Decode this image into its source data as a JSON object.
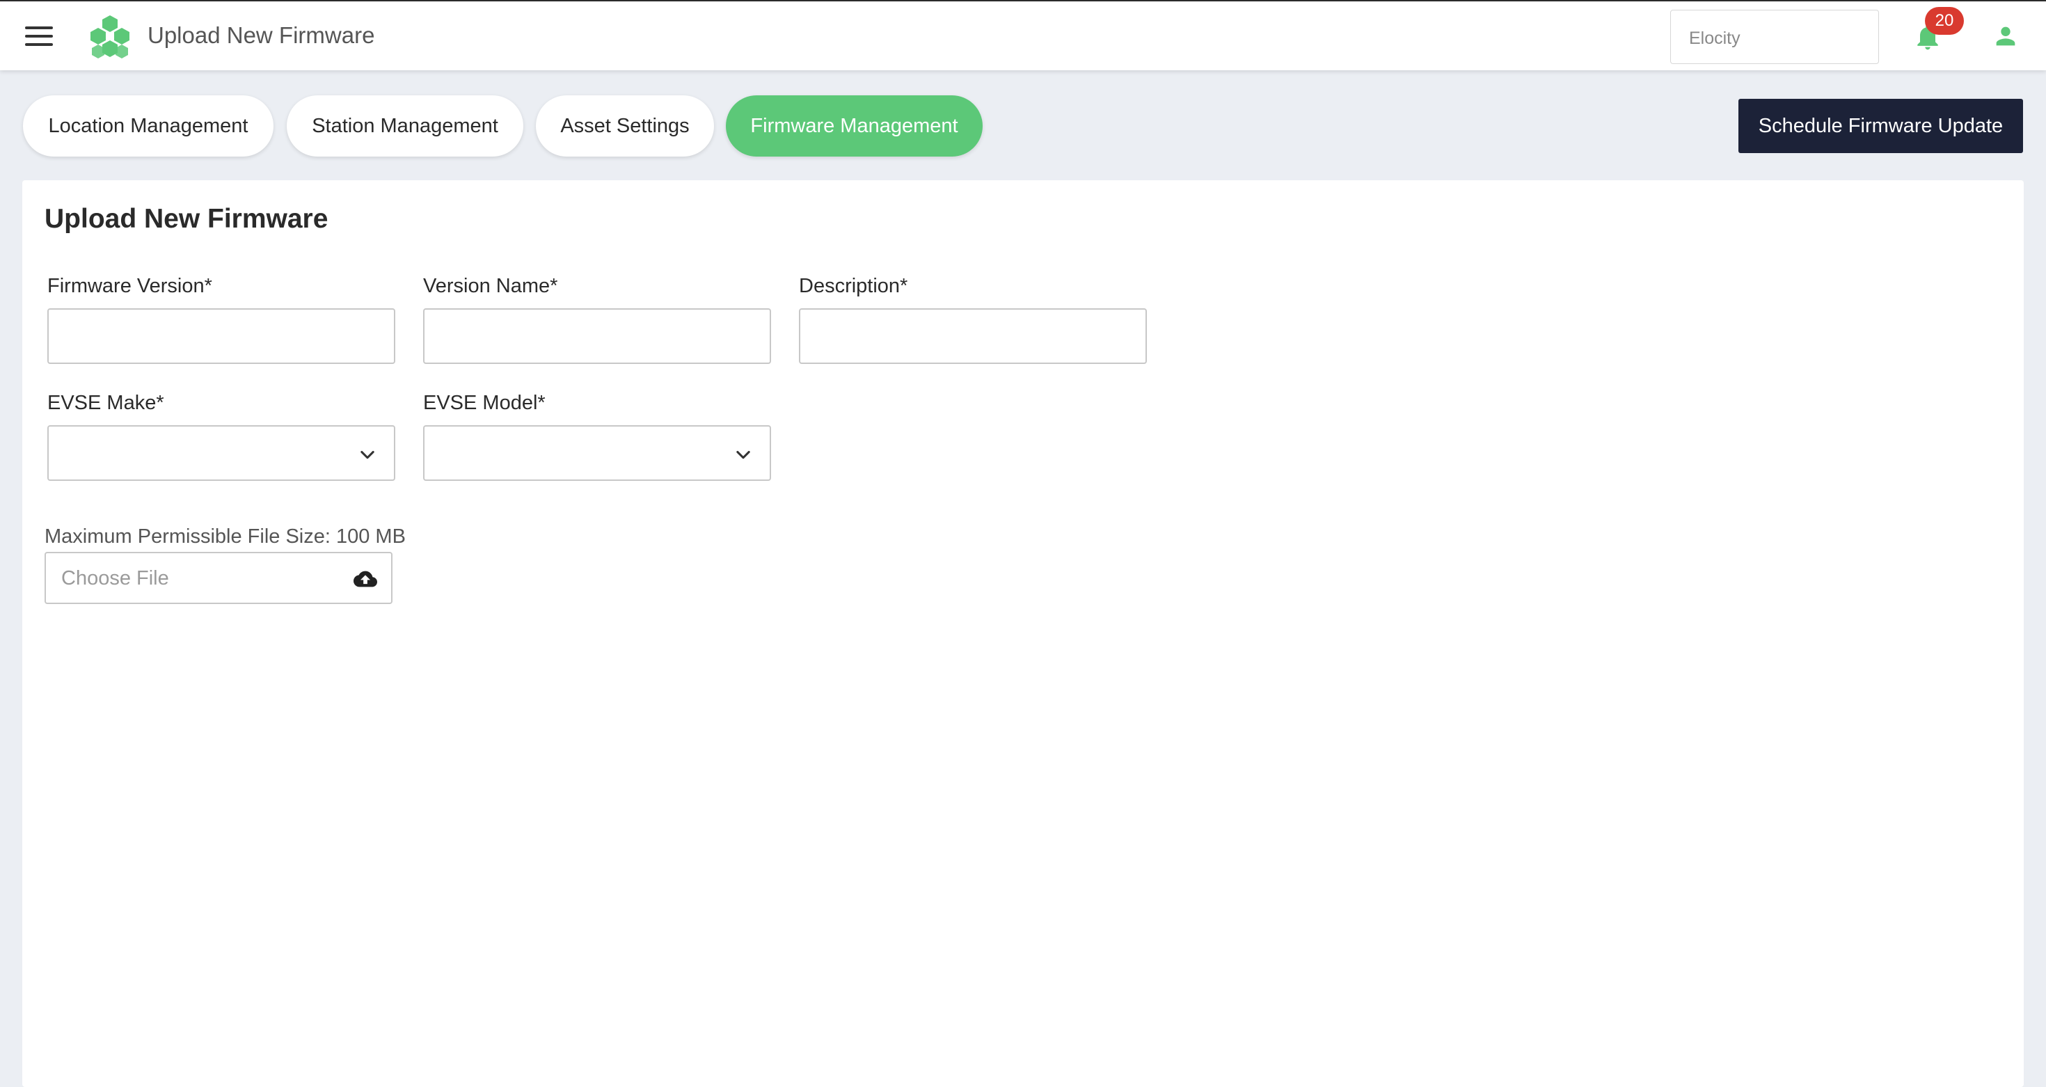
{
  "header": {
    "app_title": "Upload New Firmware",
    "org_select_value": "Elocity",
    "notification_count": "20",
    "icons": [
      "menu-icon",
      "logo-icon",
      "bell-icon",
      "user-icon"
    ],
    "accent_color": "#5cc878",
    "badge_color": "#d93a2f"
  },
  "tabs": [
    {
      "label": "Location Management",
      "active": false
    },
    {
      "label": "Station Management",
      "active": false
    },
    {
      "label": "Asset Settings",
      "active": false
    },
    {
      "label": "Firmware Management",
      "active": true
    }
  ],
  "schedule_button_label": "Schedule Firmware Update",
  "form": {
    "title": "Upload New Firmware",
    "firmware_version_label": "Firmware Version*",
    "firmware_version_value": "",
    "version_name_label": "Version Name*",
    "version_name_value": "",
    "description_label": "Description*",
    "description_value": "",
    "evse_make_label": "EVSE Make*",
    "evse_make_value": "",
    "evse_model_label": "EVSE Model*",
    "evse_model_value": "",
    "file_size_note": "Maximum Permissible File Size: 100 MB",
    "file_placeholder": "Choose File"
  }
}
